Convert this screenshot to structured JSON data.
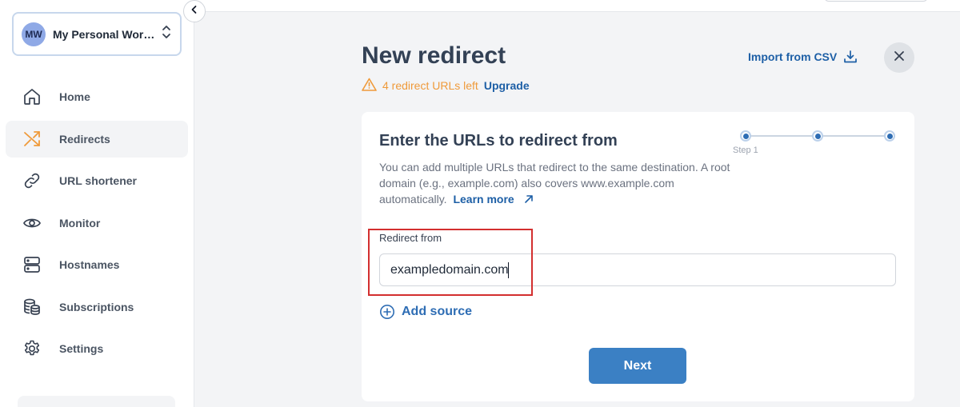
{
  "workspace": {
    "initials": "MW",
    "name": "My Personal Workspace"
  },
  "sidebar": {
    "items": [
      {
        "label": "Home",
        "icon": "home-icon"
      },
      {
        "label": "Redirects",
        "icon": "shuffle-icon",
        "active": true
      },
      {
        "label": "URL shortener",
        "icon": "link-icon"
      },
      {
        "label": "Monitor",
        "icon": "eye-icon"
      },
      {
        "label": "Hostnames",
        "icon": "server-icon"
      },
      {
        "label": "Subscriptions",
        "icon": "coins-icon"
      },
      {
        "label": "Settings",
        "icon": "gear-icon"
      }
    ]
  },
  "header": {
    "title": "New redirect",
    "quota_text": "4 redirect URLs left",
    "upgrade_label": "Upgrade",
    "import_label": "Import from CSV"
  },
  "card": {
    "title": "Enter the URLs to redirect from",
    "description": "You can add multiple URLs that redirect to the same destination. A root domain (e.g., example.com) also covers www.example.com automatically.",
    "learn_more": "Learn more",
    "step_label": "Step 1",
    "field_label": "Redirect from",
    "field_value": "exampledomain.com",
    "add_source_label": "Add source",
    "next_label": "Next"
  },
  "colors": {
    "accent": "#1d5fa6",
    "warning": "#ef9a3a",
    "primary_button": "#3b80c4",
    "highlight_box": "#d32f2f"
  }
}
